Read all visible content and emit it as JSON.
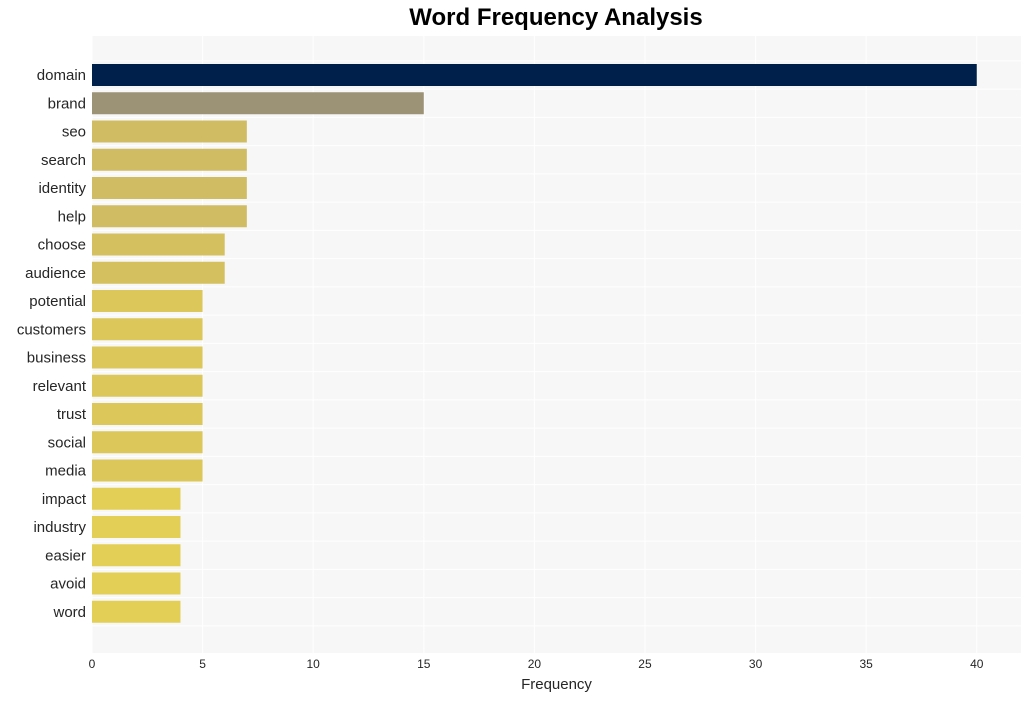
{
  "chart_data": {
    "type": "bar",
    "orientation": "horizontal",
    "title": "Word Frequency Analysis",
    "xlabel": "Frequency",
    "ylabel": "",
    "xlim": [
      0,
      42
    ],
    "xticks": [
      0,
      5,
      10,
      15,
      20,
      25,
      30,
      35,
      40
    ],
    "grid": true,
    "categories": [
      "domain",
      "brand",
      "seo",
      "search",
      "identity",
      "help",
      "choose",
      "audience",
      "potential",
      "customers",
      "business",
      "relevant",
      "trust",
      "social",
      "media",
      "impact",
      "industry",
      "easier",
      "avoid",
      "word"
    ],
    "values": [
      40,
      15,
      7,
      7,
      7,
      7,
      6,
      6,
      5,
      5,
      5,
      5,
      5,
      5,
      5,
      4,
      4,
      4,
      4,
      4
    ],
    "colors": [
      "#00204c",
      "#9c9275",
      "#d0bd63",
      "#d0bd63",
      "#d0bd63",
      "#d0bd63",
      "#d4c05f",
      "#d4c05f",
      "#dcc75a",
      "#dcc75a",
      "#dcc75a",
      "#dcc75a",
      "#dcc75a",
      "#dcc75a",
      "#dcc75a",
      "#e3cf55",
      "#e3cf55",
      "#e3cf55",
      "#e3cf55",
      "#e3cf55"
    ]
  },
  "style": {
    "plot_background": "#f7f7f7",
    "grid_color": "#ffffff"
  }
}
